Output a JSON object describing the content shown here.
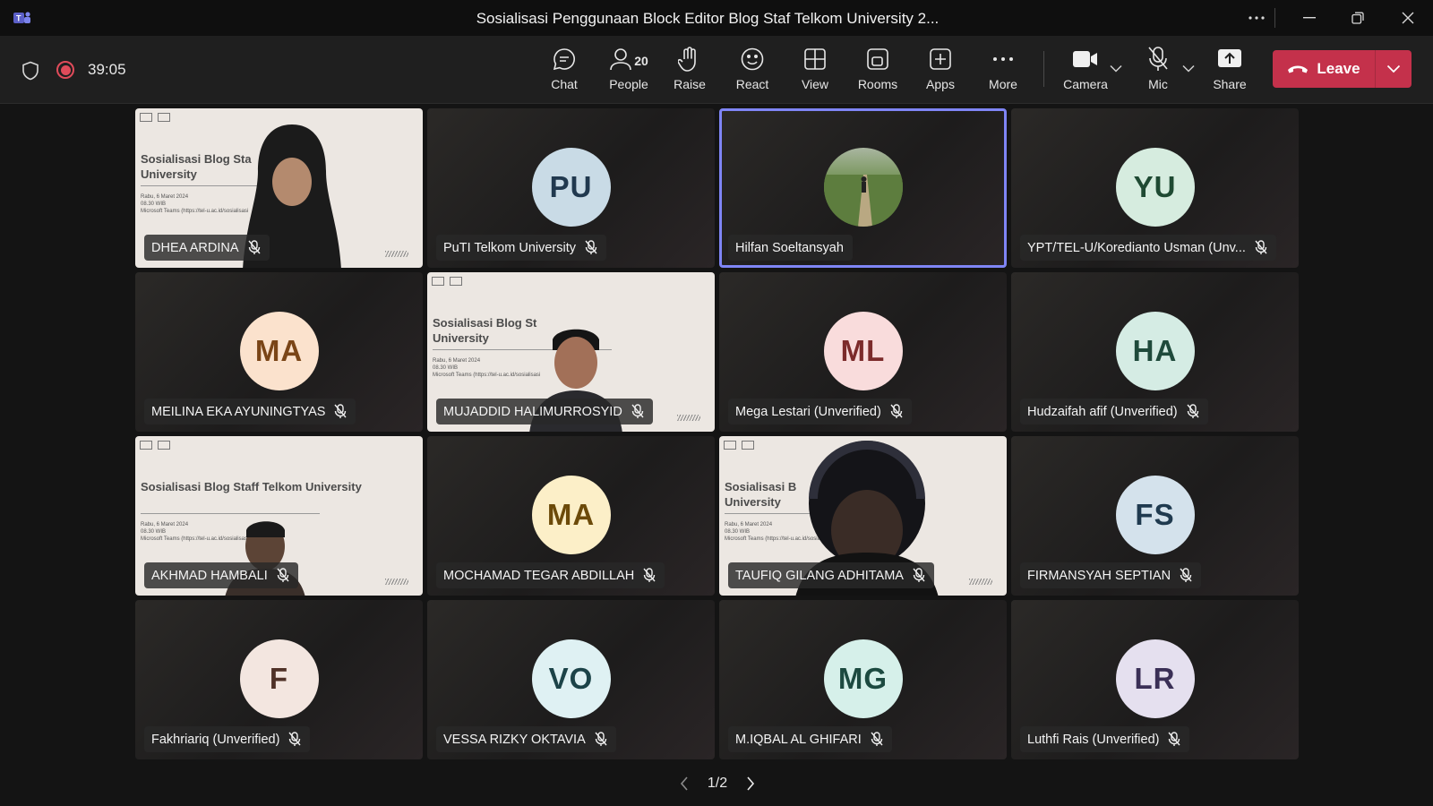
{
  "window": {
    "title": "Sosialisasi Penggunaan Block Editor Blog Staf Telkom University 2...",
    "controls": [
      "more-options",
      "minimize",
      "restore",
      "close"
    ]
  },
  "toolbar": {
    "timer": "39:05",
    "buttons": {
      "chat": "Chat",
      "people": "People",
      "people_count": "20",
      "raise": "Raise",
      "react": "React",
      "view": "View",
      "rooms": "Rooms",
      "apps": "Apps",
      "more": "More",
      "camera": "Camera",
      "mic": "Mic",
      "share": "Share"
    },
    "leave_label": "Leave",
    "leave_color": "#c4314b"
  },
  "participants": [
    {
      "name": "DHEA ARDINA",
      "initials": "",
      "video": true,
      "muted": true
    },
    {
      "name": "PuTI Telkom University",
      "initials": "PU",
      "video": false,
      "muted": true,
      "avatar_bg": "#c9dbe6",
      "avatar_fg": "#21394f"
    },
    {
      "name": "Hilfan Soeltansyah",
      "initials": "",
      "video": false,
      "muted": false,
      "photo": true,
      "active_speaker": true
    },
    {
      "name": "YPT/TEL-U/Korediantо Usman (Unv...",
      "initials": "YU",
      "video": false,
      "muted": true,
      "avatar_bg": "#d6ecdf",
      "avatar_fg": "#1f4a33"
    },
    {
      "name": "MEILINA EKA AYUNINGTYAS",
      "initials": "MA",
      "video": false,
      "muted": true,
      "avatar_bg": "#fbe2cd",
      "avatar_fg": "#7a4517"
    },
    {
      "name": "MUJADDID HALIMURROSYID",
      "initials": "",
      "video": true,
      "muted": true
    },
    {
      "name": "Mega Lestari (Unverified)",
      "initials": "ML",
      "video": false,
      "muted": true,
      "avatar_bg": "#f9dcdc",
      "avatar_fg": "#7c2b2b"
    },
    {
      "name": "Hudzaifah afif (Unverified)",
      "initials": "HA",
      "video": false,
      "muted": true,
      "avatar_bg": "#d5ece4",
      "avatar_fg": "#1f4a3b"
    },
    {
      "name": "AKHMAD HAMBALI",
      "initials": "",
      "video": true,
      "muted": true
    },
    {
      "name": "MOCHAMAD TEGAR ABDILLAH",
      "initials": "MA",
      "video": false,
      "muted": true,
      "avatar_bg": "#fcefc8",
      "avatar_fg": "#6c4a09"
    },
    {
      "name": "TAUFIQ GILANG ADHITAMA",
      "initials": "",
      "video": true,
      "muted": true
    },
    {
      "name": "FIRMANSYAH SEPTIAN",
      "initials": "FS",
      "video": false,
      "muted": true,
      "avatar_bg": "#d4e2ec",
      "avatar_fg": "#1f3a4f"
    },
    {
      "name": "Fakhriariq (Unverified)",
      "initials": "F",
      "video": false,
      "muted": true,
      "avatar_bg": "#f3e6e0",
      "avatar_fg": "#4f3127"
    },
    {
      "name": "VESSA RIZKY OKTAVIA",
      "initials": "VO",
      "video": false,
      "muted": true,
      "avatar_bg": "#dff1f3",
      "avatar_fg": "#1c4348"
    },
    {
      "name": "M.IQBAL AL GHIFARI",
      "initials": "MG",
      "video": false,
      "muted": true,
      "avatar_bg": "#d6f0ea",
      "avatar_fg": "#1c4a40"
    },
    {
      "name": "Luthfi Rais (Unverified)",
      "initials": "LR",
      "video": false,
      "muted": true,
      "avatar_bg": "#e5e0ef",
      "avatar_fg": "#3a2f56"
    }
  ],
  "slide": {
    "title_full": "Sosialisasi Blog Staff Telkom University",
    "title_short_1": "Sosialisasi Blog Sta",
    "title_short_2": "Sosialisasi Blog St",
    "title_short_3": "Sosialisasi B",
    "line2": "University",
    "detail1": "Rabu, 6 Maret 2024",
    "detail2": "08.30 WIB",
    "detail3": "Microsoft Teams (https://tel-u.ac.id/sosialisasi"
  },
  "pager": {
    "label": "1/2"
  }
}
